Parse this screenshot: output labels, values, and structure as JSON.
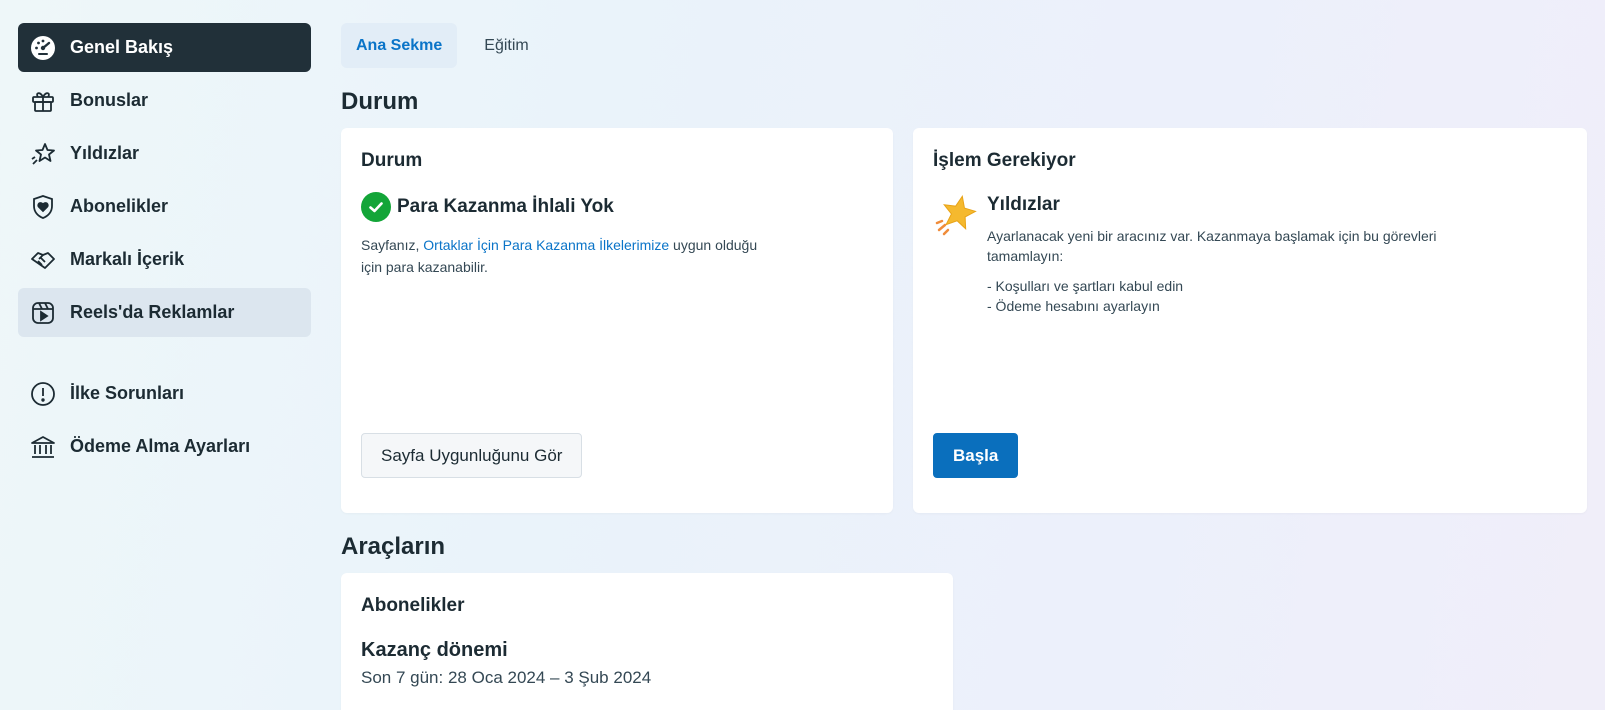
{
  "sidebar": {
    "items": [
      {
        "label": "Genel Bakış",
        "icon": "dashboard-icon"
      },
      {
        "label": "Bonuslar",
        "icon": "gift-icon"
      },
      {
        "label": "Yıldızlar",
        "icon": "stars-icon"
      },
      {
        "label": "Abonelikler",
        "icon": "heart-shield-icon"
      },
      {
        "label": "Markalı İçerik",
        "icon": "handshake-icon"
      },
      {
        "label": "Reels'da Reklamlar",
        "icon": "reels-icon"
      },
      {
        "label": "İlke Sorunları",
        "icon": "alert-circle-icon"
      },
      {
        "label": "Ödeme Alma Ayarları",
        "icon": "bank-icon"
      }
    ]
  },
  "tabs": [
    {
      "label": "Ana Sekme",
      "active": true
    },
    {
      "label": "Eğitim",
      "active": false
    }
  ],
  "sections": {
    "status_title": "Durum",
    "tools_title": "Araçların"
  },
  "status_card": {
    "title": "Durum",
    "status": "Para Kazanma İhlali Yok",
    "desc_before": "Sayfanız, ",
    "desc_link": "Ortaklar İçin Para Kazanma İlkelerimize",
    "desc_after": " uygun olduğu için para kazanabilir.",
    "button": "Sayfa Uygunluğunu Gör"
  },
  "action_card": {
    "title": "İşlem Gerekiyor",
    "task_title": "Yıldızlar",
    "task_desc": "Ayarlanacak yeni bir aracınız var. Kazanmaya başlamak için bu görevleri tamamlayın:",
    "task_items": [
      "- Koşulları ve şartları kabul edin",
      "- Ödeme hesabını ayarlayın"
    ],
    "button": "Başla"
  },
  "subscriptions_card": {
    "title": "Abonelikler",
    "period_title": "Kazanç dönemi",
    "period_range": "Son 7 gün: 28 Oca 2024 – 3 Şub 2024"
  },
  "colors": {
    "accent": "#0a74c8",
    "active_nav": "#213039",
    "success": "#13a538"
  }
}
